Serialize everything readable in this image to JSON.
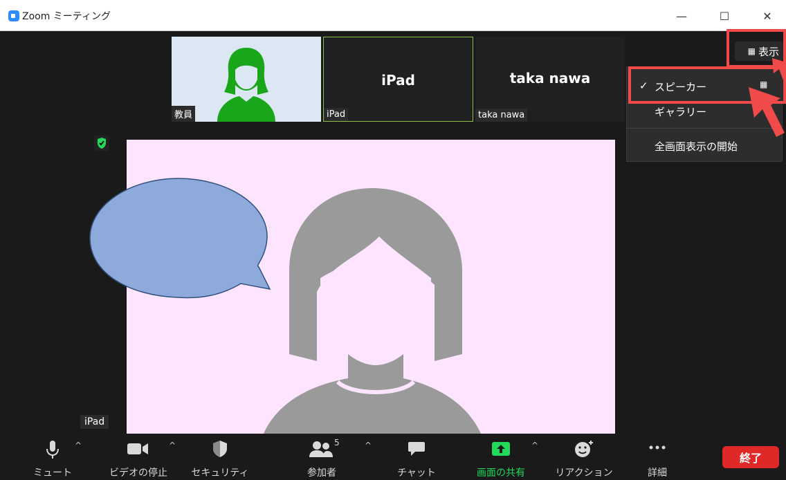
{
  "window": {
    "title": "Zoom ミーティング",
    "controls": {
      "minimize": "—",
      "maximize": "☐",
      "close": "✕"
    }
  },
  "thumbnails": [
    {
      "name": "教員",
      "big": ""
    },
    {
      "name": "iPad",
      "big": "iPad"
    },
    {
      "name": "taka nawa",
      "big": "taka nawa"
    }
  ],
  "main": {
    "active_speaker_label": "iPad"
  },
  "view": {
    "button_label": "表示",
    "menu": [
      {
        "label": "スピーカー",
        "checked": true,
        "check_mark": "✓"
      },
      {
        "label": "ギャラリー",
        "checked": false
      },
      {
        "label": "全画面表示の開始",
        "checked": false
      }
    ]
  },
  "toolbar": {
    "items": [
      {
        "label": "ミュート",
        "icon": "microphone-icon"
      },
      {
        "label": "ビデオの停止",
        "icon": "video-camera-icon"
      },
      {
        "label": "セキュリティ",
        "icon": "shield-icon"
      },
      {
        "label": "参加者",
        "icon": "participants-icon",
        "count": "5"
      },
      {
        "label": "チャット",
        "icon": "chat-icon"
      },
      {
        "label": "画面の共有",
        "icon": "share-screen-icon"
      },
      {
        "label": "リアクション",
        "icon": "reaction-icon"
      },
      {
        "label": "詳細",
        "icon": "more-icon"
      }
    ],
    "end_label": "終了"
  },
  "colors": {
    "accent_green": "#23d959",
    "end_red": "#e02828",
    "highlight_red": "#f04a4a",
    "video_bg": "#fde5ff"
  }
}
